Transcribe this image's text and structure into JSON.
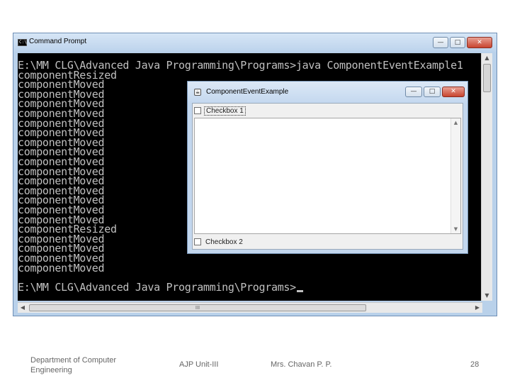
{
  "cmd": {
    "title": "Command Prompt",
    "icon": "C:\\",
    "lines": [
      "E:\\MM CLG\\Advanced Java Programming\\Programs>java ComponentEventExample1",
      "componentResized",
      "componentMoved",
      "componentMoved",
      "componentMoved",
      "componentMoved",
      "componentMoved",
      "componentMoved",
      "componentMoved",
      "componentMoved",
      "componentMoved",
      "componentMoved",
      "componentMoved",
      "componentMoved",
      "componentMoved",
      "componentMoved",
      "componentMoved",
      "componentResized",
      "componentMoved",
      "componentMoved",
      "componentMoved",
      "componentMoved",
      "",
      "E:\\MM CLG\\Advanced Java Programming\\Programs>"
    ],
    "hscroll_mark": "III"
  },
  "window_controls": {
    "minimize": "—",
    "maximize": "□",
    "close": "✕"
  },
  "java_frame": {
    "title": "ComponentEventExample",
    "checkbox1": "Checkbox 1",
    "checkbox2": "Checkbox 2",
    "checkbox1_checked": false,
    "checkbox2_checked": false
  },
  "footer": {
    "department": "Department of Computer Engineering",
    "unit": "AJP Unit-III",
    "author": "Mrs. Chavan P. P.",
    "page": "28"
  },
  "icons": [
    "cmd-icon",
    "java-frame-icon",
    "minimize-icon",
    "maximize-icon",
    "close-icon",
    "scroll-arrow-icon"
  ],
  "colors": {
    "console_bg": "#000000",
    "console_text": "#c0c0c0",
    "titlebar": "#bcd3ec",
    "close": "#c8442f"
  }
}
